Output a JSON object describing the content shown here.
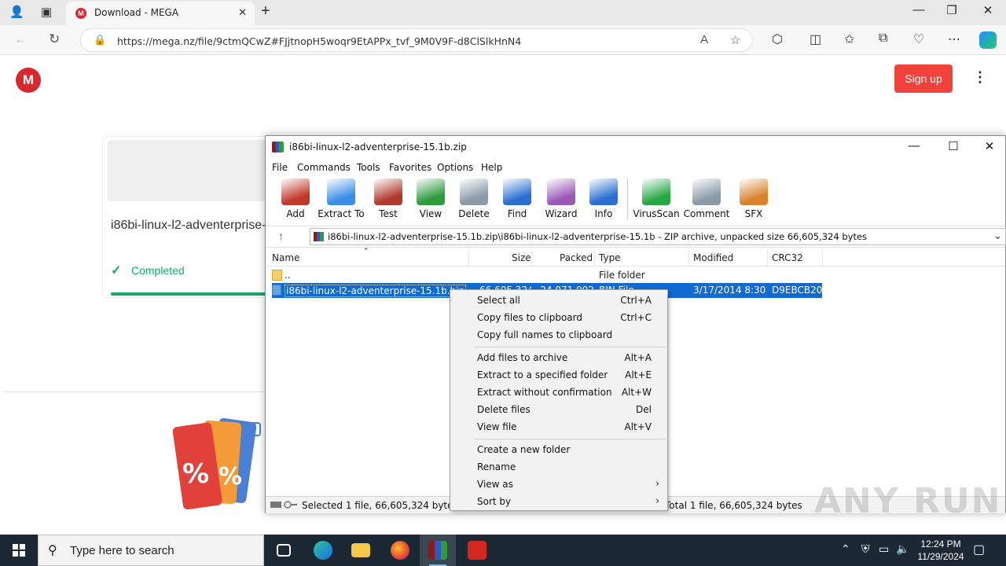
{
  "browser": {
    "tab_title": "Download - MEGA",
    "tab_close": "✕",
    "new_tab": "+",
    "url": "https://mega.nz/file/9ctmQCwZ#FJjtnopH5woqr9EtAPPx_tvf_9M0V9F-d8ClSlkHnN4",
    "win_minimize": "—",
    "win_restore": "❐",
    "win_close": "✕"
  },
  "mega": {
    "logo_letter": "M",
    "signup_label": "Sign up",
    "kebab": "⋮",
    "filename": "i86bi-linux-l2-adventerprise-15.1b.zip",
    "status": "Completed",
    "check": "✓",
    "progress": 1.0
  },
  "winrar": {
    "title": "i86bi-linux-l2-adventerprise-15.1b.zip",
    "minimize": "—",
    "maximize": "☐",
    "close": "✕",
    "menu": [
      "File",
      "Commands",
      "Tools",
      "Favorites",
      "Options",
      "Help"
    ],
    "toolbar": [
      {
        "label": "Add",
        "icon": "add-archive-icon",
        "color": "#c0392b"
      },
      {
        "label": "Extract To",
        "icon": "extract-folder-icon",
        "color": "#3a8ee6"
      },
      {
        "label": "Test",
        "icon": "test-clipboard-icon",
        "color": "#b03a2e"
      },
      {
        "label": "View",
        "icon": "view-book-icon",
        "color": "#2e9b3d"
      },
      {
        "label": "Delete",
        "icon": "trash-icon",
        "color": "#8a9aa8"
      },
      {
        "label": "Find",
        "icon": "magnifier-icon",
        "color": "#2b6fd1"
      },
      {
        "label": "Wizard",
        "icon": "wand-icon",
        "color": "#9b59b6"
      },
      {
        "label": "Info",
        "icon": "info-icon",
        "color": "#2b6fd1"
      },
      {
        "label": "VirusScan",
        "icon": "virus-icon",
        "color": "#27a844"
      },
      {
        "label": "Comment",
        "icon": "comment-icon",
        "color": "#8a9aa8"
      },
      {
        "label": "SFX",
        "icon": "sfx-books-icon",
        "color": "#d9822b"
      }
    ],
    "path": "i86bi-linux-l2-adventerprise-15.1b.zip\\i86bi-linux-l2-adventerprise-15.1b - ZIP archive, unpacked size 66,605,324 bytes",
    "columns": {
      "name": "Name",
      "size": "Size",
      "packed": "Packed",
      "type": "Type",
      "modified": "Modified",
      "crc": "CRC32"
    },
    "rows": [
      {
        "name": "..",
        "size": "",
        "packed": "",
        "type": "File folder",
        "modified": "",
        "crc": ""
      },
      {
        "name": "i86bi-linux-l2-adventerprise-15.1b.bin",
        "size": "66,605,324",
        "packed": "24,071,992",
        "type": "BIN File",
        "modified": "3/17/2014 8:30 ...",
        "crc": "D9EBCB20"
      }
    ],
    "status_left": "Selected 1 file, 66,605,324 bytes",
    "status_right": "Total 1 file, 66,605,324 bytes"
  },
  "context_menu": {
    "items": [
      {
        "label": "Select all",
        "shortcut": "Ctrl+A"
      },
      {
        "label": "Copy files to clipboard",
        "shortcut": "Ctrl+C"
      },
      {
        "label": "Copy full names to clipboard",
        "shortcut": ""
      },
      {
        "label": "Add files to archive",
        "shortcut": "Alt+A"
      },
      {
        "label": "Extract to a specified folder",
        "shortcut": "Alt+E"
      },
      {
        "label": "Extract without confirmation",
        "shortcut": "Alt+W"
      },
      {
        "label": "Delete files",
        "shortcut": "Del"
      },
      {
        "label": "View file",
        "shortcut": "Alt+V"
      },
      {
        "label": "Create a new folder",
        "shortcut": ""
      },
      {
        "label": "Rename",
        "shortcut": ""
      },
      {
        "label": "View as",
        "shortcut": ""
      },
      {
        "label": "Sort by",
        "shortcut": ""
      }
    ],
    "submenu_arrow": "›"
  },
  "watermark": "ANY RUN",
  "taskbar": {
    "search_placeholder": "Type here to search",
    "time": "12:24 PM",
    "date": "11/29/2024"
  }
}
